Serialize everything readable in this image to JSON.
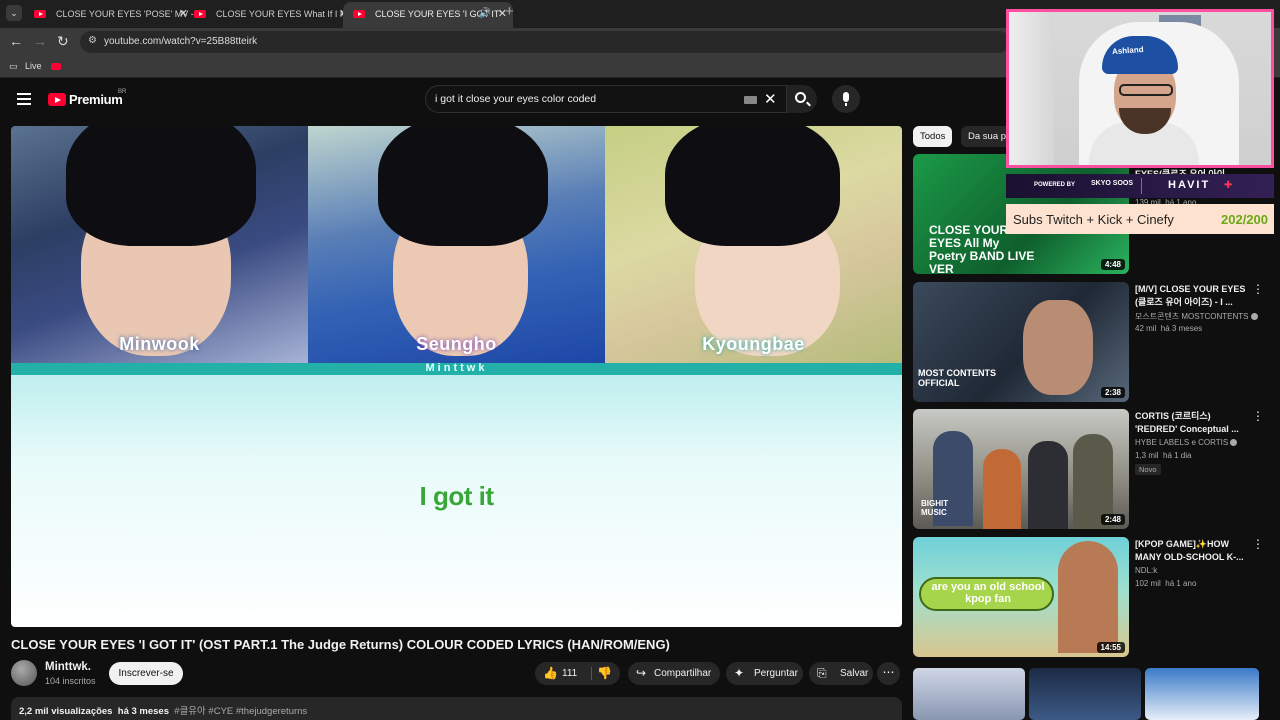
{
  "browser": {
    "tabs": [
      {
        "title": "CLOSE YOUR EYES 'POSE' MV -"
      },
      {
        "title": "CLOSE YOUR EYES What If I Mi"
      },
      {
        "title": "CLOSE YOUR EYES 'I GOT IT'"
      }
    ],
    "url": "youtube.com/watch?v=25B88tteirk",
    "bookmarks": [
      {
        "label": "Live"
      }
    ]
  },
  "header": {
    "brand": "Premium",
    "country": "BR",
    "search_query": "i got it close your eyes color coded"
  },
  "player": {
    "members": [
      "Minwook",
      "Seungho",
      "Kyoungbae"
    ],
    "watermark": "Minttwk",
    "lyric": "I got it"
  },
  "video": {
    "title": "CLOSE YOUR EYES 'I GOT IT' (OST PART.1 The Judge Returns) COLOUR CODED LYRICS (HAN/ROM/ENG)",
    "channel": "Minttwk.",
    "subscribers": "104 inscritos",
    "subscribe_label": "Inscrever-se",
    "likes": "111",
    "share_label": "Compartilhar",
    "ask_label": "Perguntar",
    "save_label": "Salvar",
    "views": "2,2 mil visualizações",
    "age": "há 3 meses",
    "tags": "#클유아 #CYE #thejudgereturns"
  },
  "sidebar": {
    "chips": [
      "Todos",
      "Da sua pesquisa"
    ],
    "recommendations": [
      {
        "title": "EYES(클로즈 유어 아이",
        "channel": "",
        "views": "139 mil",
        "age": "há 1 ano",
        "duration": "4:48",
        "thumb_text": "CLOSE YOUR EYES All My Poetry BAND LIVE VER",
        "badge": ""
      },
      {
        "title": "[M/V] CLOSE YOUR EYES (클로즈 유어 아이즈) - I ...",
        "channel": "모스트콘텐츠 MOSTCONTENTS",
        "views": "42 mil",
        "age": "há 3 meses",
        "duration": "2:38",
        "thumb_text": "MOST CONTENTS OFFICIAL",
        "badge": ""
      },
      {
        "title": "CORTIS (코르티스) 'REDRED' Conceptual ...",
        "channel": "HYBE LABELS e CORTIS",
        "views": "1,3 mil",
        "age": "há 1 dia",
        "duration": "2:48",
        "thumb_text": "BIGHIT MUSIC",
        "badge": "Novo"
      },
      {
        "title": "[KPOP GAME]✨HOW MANY OLD-SCHOOL K-...",
        "channel": "NDL:k",
        "views": "102 mil",
        "age": "há 1 ano",
        "duration": "14:55",
        "thumb_text": "are you an old school kpop fan",
        "badge": ""
      }
    ]
  },
  "overlay": {
    "cap_text": "Ashland",
    "powered_by": "POWERED BY",
    "sponsor_a": "SKYO SOOS",
    "sponsor_b": "HAVIT",
    "goal_label": "Subs Twitch + Kick + Cinefy",
    "goal_count": "202/200"
  },
  "colors": {
    "accent_red": "#ff0033",
    "lyric_green": "#3aa63a",
    "overlay_pink": "#ff4fa0",
    "goal_green": "#6aa816"
  }
}
